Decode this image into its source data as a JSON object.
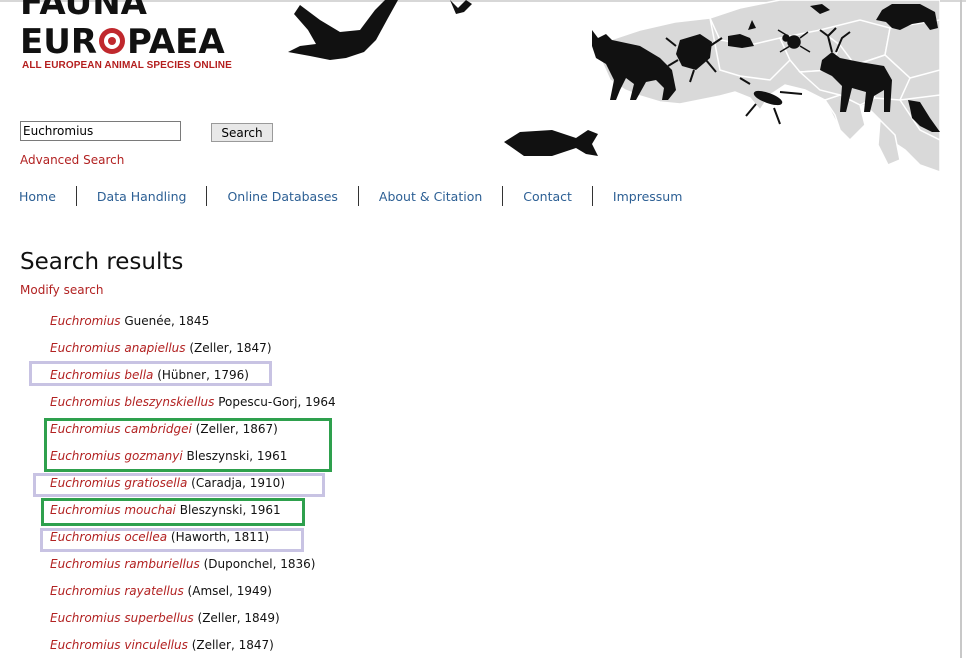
{
  "logo": {
    "line1": "FAUNA",
    "line2_pre": "EUR",
    "line2_post": "PAEA",
    "tagline": "ALL EUROPEAN ANIMAL SPECIES ONLINE",
    "accent": "#c0282d"
  },
  "search": {
    "value": "Euchromius",
    "button_label": "Search",
    "advanced_link": "Advanced Search"
  },
  "nav": {
    "items": [
      {
        "label": "Home"
      },
      {
        "label": "Data Handling"
      },
      {
        "label": "Online Databases"
      },
      {
        "label": "About & Citation"
      },
      {
        "label": "Contact"
      },
      {
        "label": "Impressum"
      }
    ]
  },
  "results": {
    "title": "Search results",
    "modify_link": "Modify search",
    "items": [
      {
        "name": "Euchromius",
        "author": "Guenée, 1845"
      },
      {
        "name": "Euchromius anapiellus",
        "author": "(Zeller, 1847)"
      },
      {
        "name": "Euchromius bella",
        "author": "(Hübner, 1796)"
      },
      {
        "name": "Euchromius bleszynskiellus",
        "author": "Popescu-Gorj, 1964"
      },
      {
        "name": "Euchromius cambridgei",
        "author": "(Zeller, 1867)"
      },
      {
        "name": "Euchromius gozmanyi",
        "author": "Bleszynski, 1961"
      },
      {
        "name": "Euchromius gratiosella",
        "author": "(Caradja, 1910)"
      },
      {
        "name": "Euchromius mouchai",
        "author": "Bleszynski, 1961"
      },
      {
        "name": "Euchromius ocellea",
        "author": "(Haworth, 1811)"
      },
      {
        "name": "Euchromius ramburiellus",
        "author": "(Duponchel, 1836)"
      },
      {
        "name": "Euchromius rayatellus",
        "author": "(Amsel, 1949)"
      },
      {
        "name": "Euchromius superbellus",
        "author": "(Zeller, 1849)"
      },
      {
        "name": "Euchromius vinculellus",
        "author": "(Zeller, 1847)"
      }
    ]
  },
  "colors": {
    "link_red": "#b22222",
    "nav_blue": "#2c5f94",
    "highlight_lavender": "#c8c3e3",
    "highlight_green": "#2ea04d"
  }
}
